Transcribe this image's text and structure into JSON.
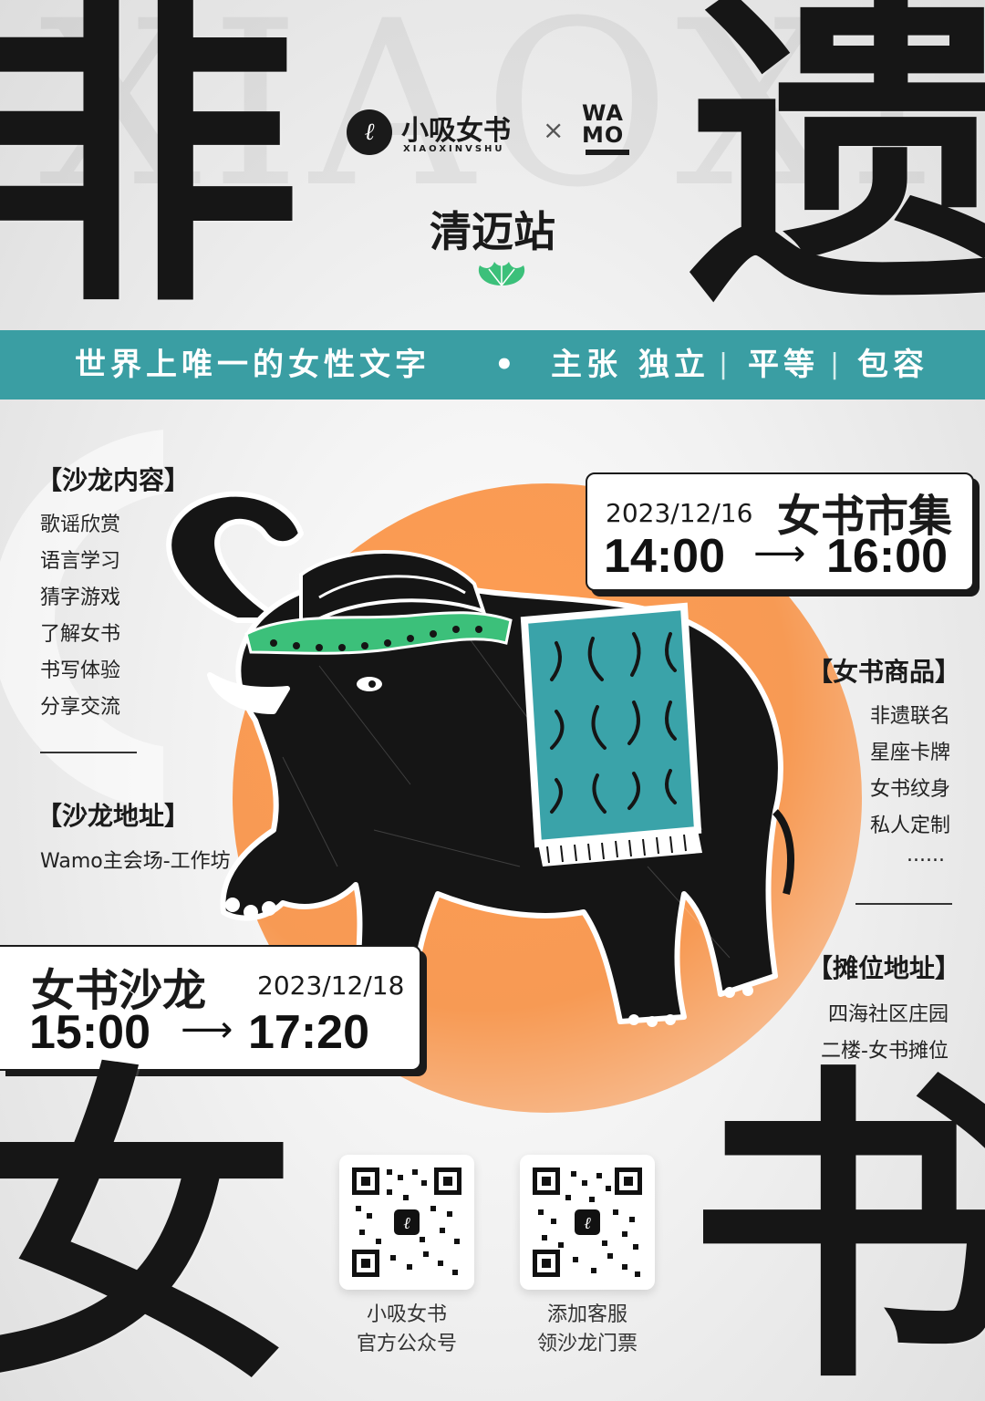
{
  "poster": {
    "background_latin": "XIAOXI",
    "big_chars": {
      "top_left": "非",
      "top_right": "遗",
      "bottom_left": "女",
      "bottom_right": "书"
    },
    "logos": {
      "brand_name": "小吸女书",
      "brand_sub": "XIAOXINVSHU",
      "brand_mark": "ℓ",
      "times": "×",
      "partner": "WA MO"
    },
    "station": "清迈站",
    "banner": {
      "slogan": "世界上唯一的女性文字",
      "dot": "•",
      "claim": "主张",
      "value1": "独立",
      "sep": "|",
      "value2": "平等",
      "value3": "包容"
    },
    "salon_content": {
      "title": "【沙龙内容】",
      "items": [
        "歌谣欣赏",
        "语言学习",
        "猜字游戏",
        "了解女书",
        "书写体验",
        "分享交流"
      ]
    },
    "salon_address": {
      "title": "【沙龙地址】",
      "value": "Wamo主会场-工作坊"
    },
    "market_card": {
      "title": "女书市集",
      "date": "2023/12/16",
      "start": "14:00",
      "arrow": "⟶",
      "end": "16:00"
    },
    "goods": {
      "title": "【女书商品】",
      "items": [
        "非遗联名",
        "星座卡牌",
        "女书纹身",
        "私人定制",
        "......"
      ]
    },
    "stall_address": {
      "title": "【摊位地址】",
      "lines": [
        "四海社区庄园",
        "二楼-女书摊位"
      ]
    },
    "salon_card": {
      "title": "女书沙龙",
      "date": "2023/12/18",
      "start": "15:00",
      "arrow": "⟶",
      "end": "17:20"
    },
    "qr_codes": [
      {
        "line1": "小吸女书",
        "line2": "官方公众号"
      },
      {
        "line1": "添加客服",
        "line2": "领沙龙门票"
      }
    ],
    "colors": {
      "teal": "#3a9ea3",
      "orange": "#f79a54",
      "green": "#3cc07a",
      "ink": "#1a1a1a"
    }
  }
}
